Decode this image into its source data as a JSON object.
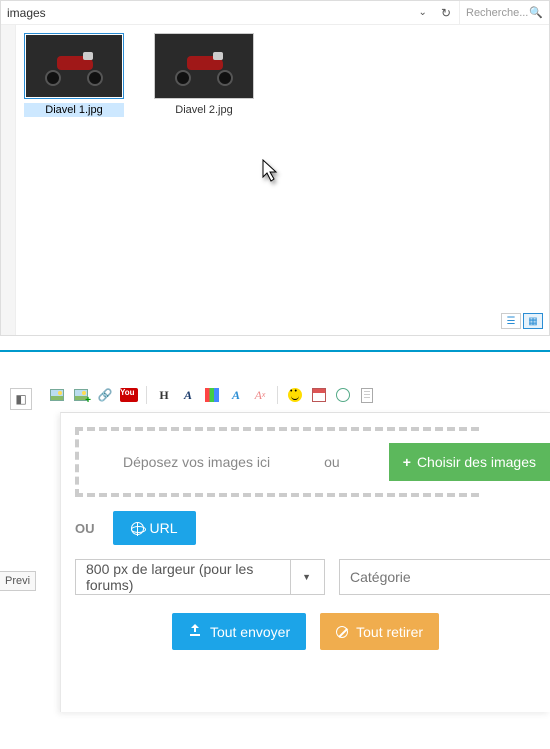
{
  "file_browser": {
    "crumb": "images",
    "search_placeholder": "Recherche...",
    "thumbs": [
      {
        "label": "Diavel 1.jpg",
        "selected": true
      },
      {
        "label": "Diavel 2.jpg",
        "selected": false
      }
    ]
  },
  "toolbar": {
    "icons": [
      "insert-image",
      "add-image",
      "insert-link",
      "youtube",
      "heading",
      "font-style",
      "color-swatch",
      "font-style-alt",
      "clear-format",
      "emoji",
      "calendar",
      "globe",
      "document"
    ]
  },
  "upload": {
    "drop_text": "Déposez vos images ici",
    "or1": "ou",
    "choose_label": "Choisir des images",
    "or2": "ou",
    "url_label": "URL",
    "size_option": "800 px de largeur (pour les forums)",
    "category_placeholder": "Catégorie",
    "send_all": "Tout envoyer",
    "remove_all": "Tout retirer"
  },
  "preview_tab": "Previ"
}
